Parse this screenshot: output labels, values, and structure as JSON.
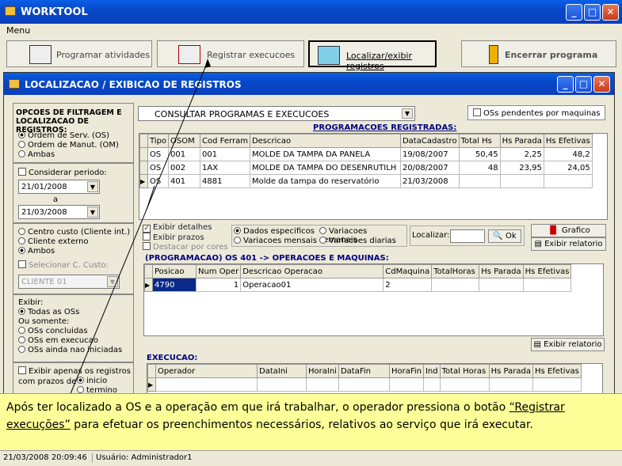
{
  "app": {
    "title": "WORKTOOL",
    "menu": "Menu"
  },
  "toolbar": [
    {
      "label": "Programar atividades"
    },
    {
      "label": "Registrar execucoes"
    },
    {
      "label": "Localizar/exibir registros"
    },
    {
      "label": "Encerrar programa"
    }
  ],
  "window": {
    "title": "LOCALIZACAO / EXIBICAO DE REGISTROS"
  },
  "filters": {
    "title": "OPCOES DE FILTRAGEM E LOCALIZACAO DE REGISTROS:",
    "type_options": [
      "Ordem de Serv. (OS)",
      "Ordem de Manut. (OM)",
      "Ambas"
    ],
    "period_label": "Considerar periodo:",
    "date_from": "21/01/2008",
    "date_sep": "a",
    "date_to": "21/03/2008",
    "cost_options": [
      "Centro custo (Cliente int.)",
      "Cliente externo",
      "Ambos"
    ],
    "select_cost_label": "Selecionar C. Custo:",
    "select_cost_value": "CLIENTE 01",
    "show_label": "Exibir:",
    "show_all": "Todas as OSs",
    "only_label": "Ou somente:",
    "only_options": [
      "OSs concluidas",
      "OSs em execucao",
      "OSs ainda nao iniciadas"
    ],
    "deadline_label": "Exibir apenas os registros com prazos de",
    "deadline_opts": [
      "inicio",
      "termino"
    ]
  },
  "query": {
    "combo_value": "CONSULTAR PROGRAMAS E EXECUCOES",
    "pending_label": "OSs pendentes por maquinas"
  },
  "programs": {
    "header": "PROGRAMACOES REGISTRADAS:",
    "columns": [
      "Tipo",
      "OSOM",
      "Cod Ferram",
      "Descricao",
      "DataCadastro",
      "Total Hs",
      "Hs Parada",
      "Hs Efetivas"
    ],
    "rows": [
      [
        "OS",
        "001",
        "001",
        "MOLDE DA TAMPA DA PANELA",
        "19/08/2007",
        "50,45",
        "2,25",
        "48,2"
      ],
      [
        "OS",
        "002",
        "1AX",
        "MOLDE DA TAMPA DO DESENRUTILH",
        "20/08/2007",
        "48",
        "23,95",
        "24,05"
      ],
      [
        "OS",
        "401",
        "4881",
        "Molde da tampa do reservatório",
        "21/03/2008",
        "",
        "",
        ""
      ]
    ]
  },
  "options": {
    "show_details": "Exibir detalhes",
    "show_deadlines": "Exibir prazos",
    "highlight_colors": "Destacar por cores",
    "data_opts": [
      "Dados especificos",
      "Variacoes semanais",
      "Variacoes mensais",
      "Variacoes diarias"
    ],
    "search_label": "Localizar:",
    "ok": "Ok",
    "chart": "Grafico",
    "report": "Exibir relatorio"
  },
  "operations": {
    "header": "(PROGRAMACAO) OS 401 -> OPERACOES E MAQUINAS:",
    "columns": [
      "Posicao",
      "Num Oper",
      "Descricao Operacao",
      "CdMaquina",
      "TotalHoras",
      "Hs Parada",
      "Hs Efetivas"
    ],
    "rows": [
      [
        "4790",
        "1",
        "Operacao01",
        "2",
        "",
        "",
        ""
      ]
    ],
    "report": "Exibir relatorio"
  },
  "execution": {
    "header": "EXECUCAO:",
    "columns": [
      "Operador",
      "DataIni",
      "HoraIni",
      "DataFin",
      "HoraFin",
      "Ind",
      "Total Horas",
      "Hs Parada",
      "Hs Efetivas"
    ]
  },
  "caption": {
    "pre": "Após ter localizado a OS e a operação em que irá trabalhar, o operador pressiona o botão",
    "link": "“Registrar execuções”",
    "post": " para efetuar os preenchimentos necessários, relativos ao serviço que irá executar."
  },
  "status": {
    "datetime": "21/03/2008 20:09:46",
    "user": "Usuário: Administrador1"
  }
}
